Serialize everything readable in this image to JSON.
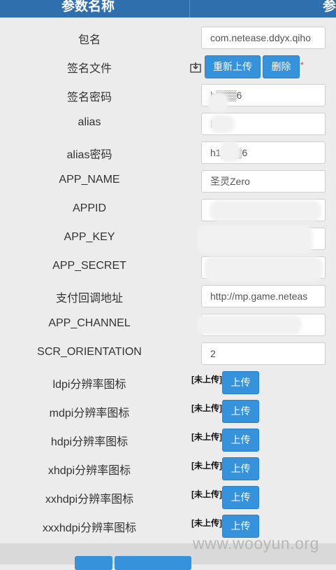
{
  "header": {
    "col1": "参数名称",
    "col2": "参"
  },
  "rows": [
    {
      "label": "包名",
      "value": "com.netease.ddyx.qiho"
    },
    {
      "label": "签名文件"
    },
    {
      "label": "签名密码",
      "value": "h▒▒▒6"
    },
    {
      "label": "alias",
      "value": "h"
    },
    {
      "label": "alias密码",
      "value": "h1▒▒▒6"
    },
    {
      "label": "APP_NAME",
      "value": "圣灵Zero"
    },
    {
      "label": "APPID",
      "value": ""
    },
    {
      "label": "APP_KEY",
      "value": ""
    },
    {
      "label": "APP_SECRET",
      "value": ""
    },
    {
      "label": "支付回调地址",
      "value": "http://mp.game.neteas"
    },
    {
      "label": "APP_CHANNEL",
      "value": ""
    },
    {
      "label": "SCR_ORIENTATION",
      "value": "2"
    }
  ],
  "signfile": {
    "reupload": "重新上传",
    "delete": "删除",
    "required_mark": "*"
  },
  "icons": [
    {
      "label": "ldpi分辨率图标",
      "status": "[未上传]",
      "button": "上传"
    },
    {
      "label": "mdpi分辨率图标",
      "status": "[未上传]",
      "button": "上传"
    },
    {
      "label": "hdpi分辨率图标",
      "status": "[未上传]",
      "button": "上传"
    },
    {
      "label": "xhdpi分辨率图标",
      "status": "[未上传]",
      "button": "上传"
    },
    {
      "label": "xxhdpi分辨率图标",
      "status": "[未上传]",
      "button": "上传"
    },
    {
      "label": "xxxhdpi分辨率图标",
      "status": "[未上传]",
      "button": "上传"
    }
  ],
  "watermark": "www.wooyun.org",
  "colors": {
    "header": "#2f6fae",
    "button": "#3592db",
    "required": "#d9364a"
  }
}
